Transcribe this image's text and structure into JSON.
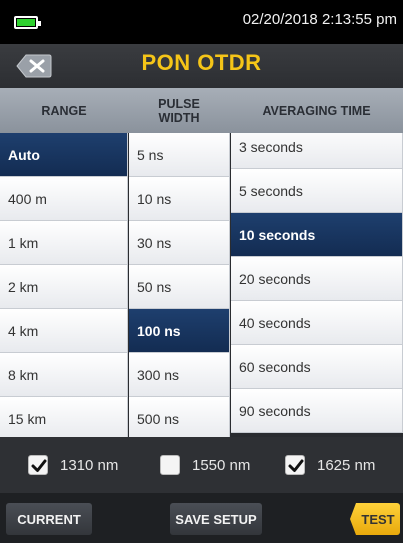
{
  "status": {
    "datetime": "02/20/2018 2:13:55 pm"
  },
  "title_bar": {
    "title": "PON OTDR",
    "back_icon": "back-x-icon"
  },
  "headers": {
    "range": "RANGE",
    "pulse_width": [
      "PULSE",
      "WIDTH"
    ],
    "averaging_time": "AVERAGING TIME"
  },
  "range": {
    "items": [
      "Auto",
      "400 m",
      "1 km",
      "2 km",
      "4 km",
      "8 km",
      "15 km"
    ],
    "selected": "Auto"
  },
  "pulse_width": {
    "items": [
      "5 ns",
      "10 ns",
      "30 ns",
      "50 ns",
      "100 ns",
      "300 ns",
      "500 ns"
    ],
    "selected": "100 ns"
  },
  "averaging_time": {
    "items": [
      "3 seconds",
      "5 seconds",
      "10 seconds",
      "20 seconds",
      "40 seconds",
      "60 seconds",
      "90 seconds"
    ],
    "selected": "10 seconds"
  },
  "wavelengths": [
    {
      "label": "1310 nm",
      "checked": true
    },
    {
      "label": "1550 nm",
      "checked": false
    },
    {
      "label": "1625 nm",
      "checked": true
    }
  ],
  "buttons": {
    "current": "CURRENT",
    "save_setup": "SAVE SETUP",
    "test": "TEST"
  },
  "colors": {
    "accent": "#f5c518",
    "selected": "#1e3f6e",
    "battery": "#2fd12f"
  }
}
